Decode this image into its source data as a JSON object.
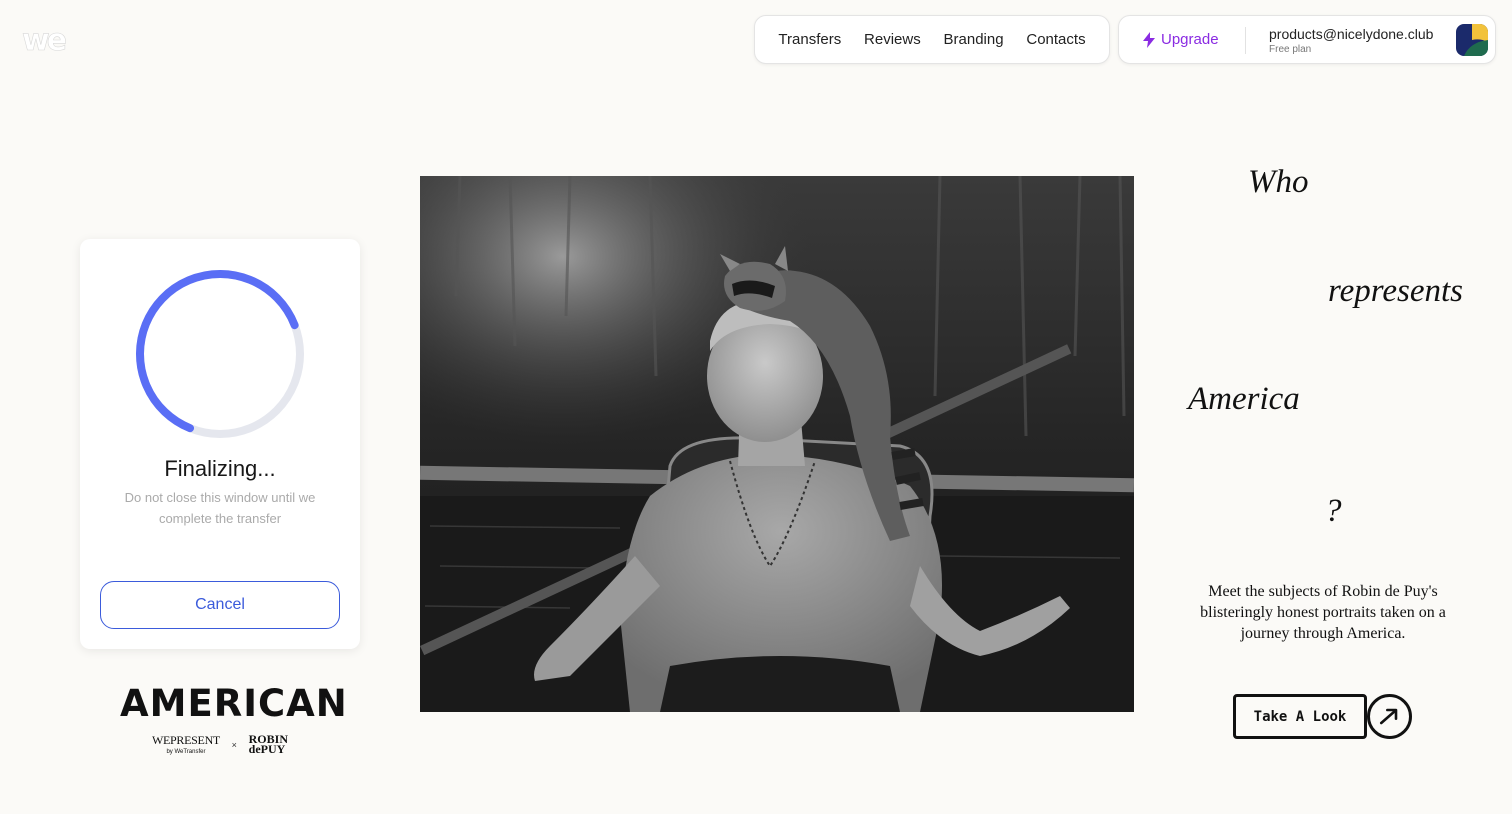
{
  "nav": {
    "items": [
      {
        "label": "Transfers"
      },
      {
        "label": "Reviews"
      },
      {
        "label": "Branding"
      },
      {
        "label": "Contacts"
      }
    ]
  },
  "account": {
    "upgrade_label": "Upgrade",
    "email": "products@nicelydone.club",
    "plan": "Free plan"
  },
  "transfer": {
    "title": "Finalizing...",
    "hint": "Do not close this window until we complete the transfer",
    "cancel_label": "Cancel",
    "progress_fraction": 0.63,
    "accent_color": "#5a6ef5",
    "track_color": "#e5e7ee"
  },
  "promo": {
    "brand_wordmark": "AMERICAN",
    "brand_sub_left": "WEPRESENT",
    "brand_sub_left_small": "by WeTransfer",
    "brand_sub_times": "×",
    "brand_sub_right_1": "ROBIN",
    "brand_sub_right_2": "dePUY",
    "words": [
      "Who",
      "represents",
      "America",
      "?"
    ],
    "description": "Meet the subjects of Robin de Puy's blisteringly honest portraits taken on a journey through America.",
    "cta_label": "Take A Look"
  }
}
